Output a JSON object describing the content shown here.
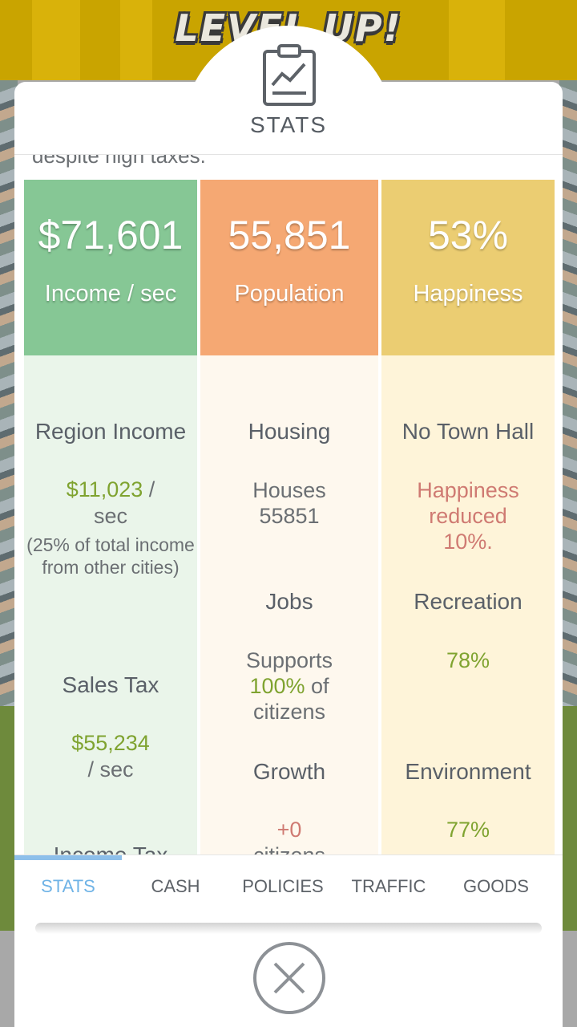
{
  "background": {
    "banner_text": "LEVEL UP!"
  },
  "header": {
    "icon": "clipboard-chart-icon",
    "title": "STATS"
  },
  "intro_text": "despite high taxes.",
  "columns": [
    {
      "stat_value": "$71,601",
      "stat_label": "Income / sec",
      "color": "#86c795",
      "sections": [
        {
          "title": "Region Income",
          "value": "$11,023",
          "value_suffix": " /",
          "line2": "sec",
          "note": "(25% of total income from other cities)"
        },
        {
          "title": "Sales Tax",
          "value": "$55,234",
          "line2": "/ sec"
        },
        {
          "title": "Income Tax"
        }
      ]
    },
    {
      "stat_value": "55,851",
      "stat_label": "Population",
      "color": "#f5a873",
      "sections": [
        {
          "title": "Housing",
          "line1": "Houses",
          "line2": "55851"
        },
        {
          "title": "Jobs",
          "line1": "Supports",
          "value": "100%",
          "value_suffix": " of",
          "line2": "citizens"
        },
        {
          "title": "Growth",
          "value": "+0",
          "line2": "citizens"
        }
      ]
    },
    {
      "stat_value": "53%",
      "stat_label": "Happiness",
      "color": "#ebcd72",
      "sections": [
        {
          "title": "No Town Hall",
          "warning": [
            "Happiness",
            "reduced",
            "10%."
          ]
        },
        {
          "title": "Recreation",
          "value": "78%"
        },
        {
          "title": "Environment",
          "value": "77%"
        }
      ]
    }
  ],
  "tabs": [
    {
      "label": "STATS",
      "active": true
    },
    {
      "label": "CASH"
    },
    {
      "label": "POLICIES"
    },
    {
      "label": "TRAFFIC"
    },
    {
      "label": "GOODS"
    }
  ],
  "close_icon": "close-x-icon",
  "colors": {
    "accent_blue": "#6fb3e6",
    "positive_green": "#7fa330",
    "warning_red": "#cf7a72"
  }
}
